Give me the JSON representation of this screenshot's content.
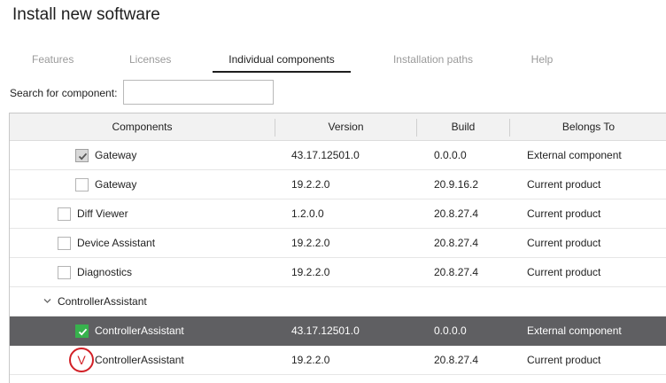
{
  "window": {
    "title": "Install new software"
  },
  "tabs": [
    {
      "label": "Features",
      "active": false
    },
    {
      "label": "Licenses",
      "active": false
    },
    {
      "label": "Individual components",
      "active": true
    },
    {
      "label": "Installation paths",
      "active": false
    },
    {
      "label": "Help",
      "active": false
    }
  ],
  "search": {
    "label": "Search for component:",
    "value": "",
    "placeholder": ""
  },
  "grid": {
    "columns": [
      "Components",
      "Version",
      "Build",
      "Belongs To"
    ],
    "rows": [
      {
        "name": "Gateway",
        "version": "43.17.12501.0",
        "build": "0.0.0.0",
        "belongs_to": "External component",
        "checked": true,
        "selected": false
      },
      {
        "name": "Gateway",
        "version": "19.2.2.0",
        "build": "20.9.16.2",
        "belongs_to": "Current product",
        "checked": false,
        "selected": false
      },
      {
        "name": "Diff Viewer",
        "version": "1.2.0.0",
        "build": "20.8.27.4",
        "belongs_to": "Current product",
        "checked": false,
        "selected": false
      },
      {
        "name": "Device Assistant",
        "version": "19.2.2.0",
        "build": "20.8.27.4",
        "belongs_to": "Current product",
        "checked": false,
        "selected": false
      },
      {
        "name": "Diagnostics",
        "version": "19.2.2.0",
        "build": "20.8.27.4",
        "belongs_to": "Current product",
        "checked": false,
        "selected": false
      },
      {
        "name": "ControllerAssistant",
        "group": true,
        "expanded": true
      },
      {
        "name": "ControllerAssistant",
        "version": "43.17.12501.0",
        "build": "0.0.0.0",
        "belongs_to": "External component",
        "checked": true,
        "selected": true
      },
      {
        "name": "ControllerAssistant",
        "version": "19.2.2.0",
        "build": "20.8.27.4",
        "belongs_to": "Current product",
        "checked": false,
        "selected": false
      }
    ]
  },
  "annotation": {
    "mark": "V",
    "color": "#d21f26"
  },
  "colors": {
    "selected_row": "#5f5f62",
    "check_green": "#37b24d",
    "header_bg": "#f2f2f2"
  }
}
